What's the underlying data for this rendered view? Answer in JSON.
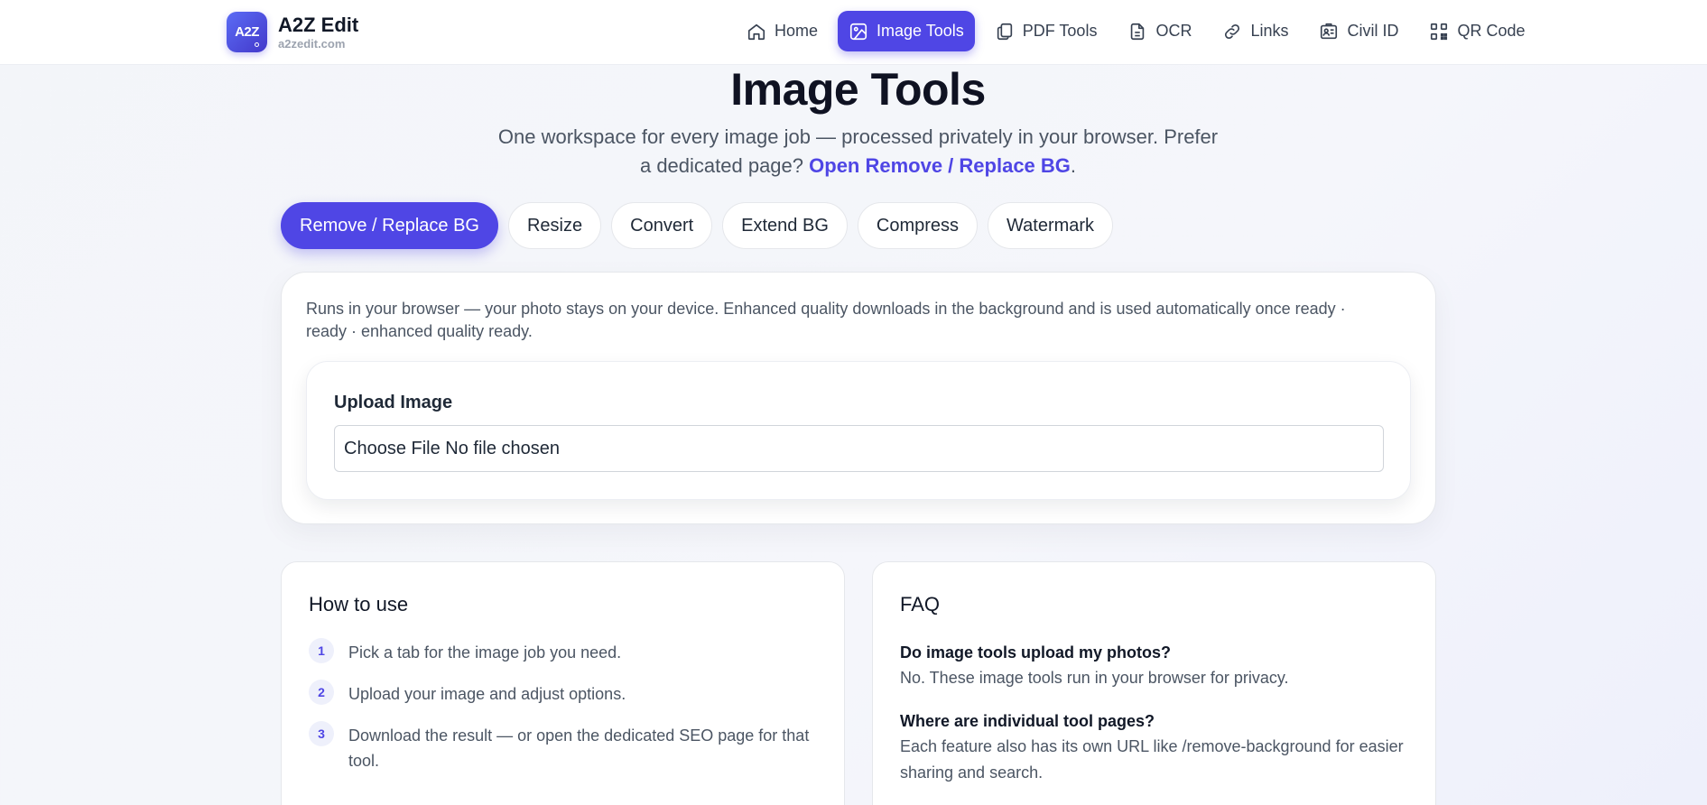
{
  "brand": {
    "logo_text": "A2Z",
    "name": "A2Z Edit",
    "domain": "a2zedit.com"
  },
  "nav": {
    "items": [
      {
        "label": "Home",
        "icon": "home-icon"
      },
      {
        "label": "Image Tools",
        "icon": "image-icon",
        "active": true
      },
      {
        "label": "PDF Tools",
        "icon": "files-icon"
      },
      {
        "label": "OCR",
        "icon": "document-icon"
      },
      {
        "label": "Links",
        "icon": "link-icon"
      },
      {
        "label": "Civil ID",
        "icon": "id-card-icon"
      },
      {
        "label": "QR Code",
        "icon": "qr-code-icon"
      }
    ]
  },
  "hero": {
    "title": "Image Tools",
    "subtitle_before": "One workspace for every image job — processed privately in your browser. Prefer a dedicated page? ",
    "subtitle_link": "Open Remove / Replace BG",
    "subtitle_after": "."
  },
  "tabs": [
    {
      "label": "Remove / Replace BG",
      "active": true
    },
    {
      "label": "Resize"
    },
    {
      "label": "Convert"
    },
    {
      "label": "Extend BG"
    },
    {
      "label": "Compress"
    },
    {
      "label": "Watermark"
    }
  ],
  "tool": {
    "note": "Runs in your browser — your photo stays on your device. Enhanced quality downloads in the background and is used automatically once ready · ready · enhanced quality ready.",
    "upload_label": "Upload Image",
    "file_input_text": "Choose File No file chosen"
  },
  "how_to": {
    "title": "How to use",
    "steps": [
      {
        "num": "1",
        "text": "Pick a tab for the image job you need."
      },
      {
        "num": "2",
        "text": "Upload your image and adjust options."
      },
      {
        "num": "3",
        "text": "Download the result — or open the dedicated SEO page for that tool."
      }
    ]
  },
  "faq": {
    "title": "FAQ",
    "items": [
      {
        "q": "Do image tools upload my photos?",
        "a": "No. These image tools run in your browser for privacy."
      },
      {
        "q": "Where are individual tool pages?",
        "a": "Each feature also has its own URL like /remove-background for easier sharing and search."
      }
    ]
  },
  "colors": {
    "accent": "#4f46e5",
    "text": "#111827",
    "muted": "#4b5563"
  }
}
